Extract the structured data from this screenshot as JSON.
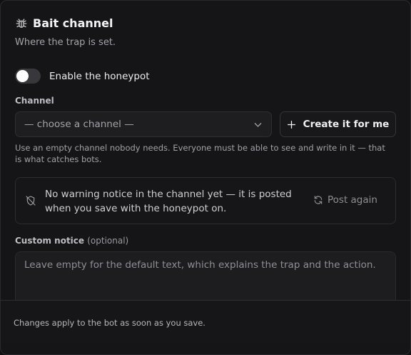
{
  "header": {
    "icon": "bug-icon",
    "title": "Bait channel",
    "subtitle": "Where the trap is set."
  },
  "honeypot_toggle": {
    "label": "Enable the honeypot",
    "enabled": false
  },
  "channel": {
    "label": "Channel",
    "select_value": "— choose a channel —",
    "create_button_label": "Create it for me",
    "hint": "Use an empty channel nobody needs. Everyone must be able to see and write in it — that is what catches bots."
  },
  "warning_notice": {
    "icon": "shield-off-icon",
    "text": "No warning notice in the channel yet — it is posted when you save with the honeypot on.",
    "action_label": "Post again",
    "action_icon": "refresh-icon"
  },
  "custom_notice": {
    "label": "Custom notice",
    "optional": "(optional)",
    "placeholder": "Leave empty for the default text, which explains the trap and the action."
  },
  "footer": {
    "text": "Changes apply to the bot as soon as you save."
  }
}
